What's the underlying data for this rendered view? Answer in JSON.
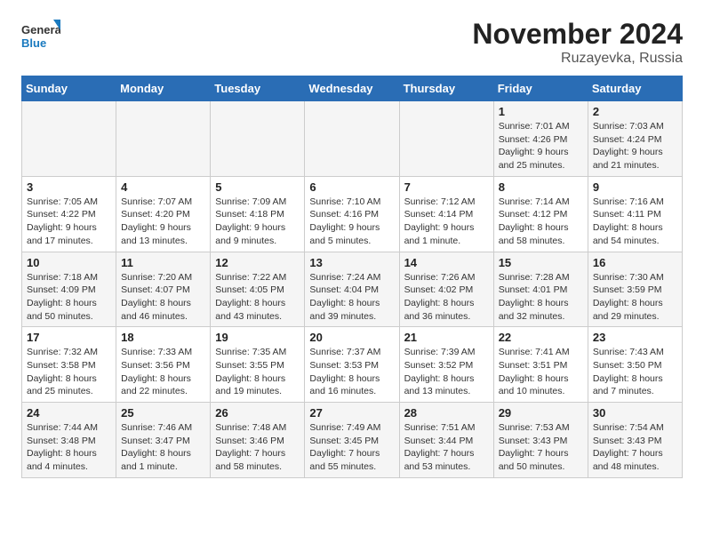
{
  "header": {
    "logo_general": "General",
    "logo_blue": "Blue",
    "month_year": "November 2024",
    "location": "Ruzayevka, Russia"
  },
  "weekdays": [
    "Sunday",
    "Monday",
    "Tuesday",
    "Wednesday",
    "Thursday",
    "Friday",
    "Saturday"
  ],
  "weeks": [
    [
      {
        "day": "",
        "info": ""
      },
      {
        "day": "",
        "info": ""
      },
      {
        "day": "",
        "info": ""
      },
      {
        "day": "",
        "info": ""
      },
      {
        "day": "",
        "info": ""
      },
      {
        "day": "1",
        "info": "Sunrise: 7:01 AM\nSunset: 4:26 PM\nDaylight: 9 hours\nand 25 minutes."
      },
      {
        "day": "2",
        "info": "Sunrise: 7:03 AM\nSunset: 4:24 PM\nDaylight: 9 hours\nand 21 minutes."
      }
    ],
    [
      {
        "day": "3",
        "info": "Sunrise: 7:05 AM\nSunset: 4:22 PM\nDaylight: 9 hours\nand 17 minutes."
      },
      {
        "day": "4",
        "info": "Sunrise: 7:07 AM\nSunset: 4:20 PM\nDaylight: 9 hours\nand 13 minutes."
      },
      {
        "day": "5",
        "info": "Sunrise: 7:09 AM\nSunset: 4:18 PM\nDaylight: 9 hours\nand 9 minutes."
      },
      {
        "day": "6",
        "info": "Sunrise: 7:10 AM\nSunset: 4:16 PM\nDaylight: 9 hours\nand 5 minutes."
      },
      {
        "day": "7",
        "info": "Sunrise: 7:12 AM\nSunset: 4:14 PM\nDaylight: 9 hours\nand 1 minute."
      },
      {
        "day": "8",
        "info": "Sunrise: 7:14 AM\nSunset: 4:12 PM\nDaylight: 8 hours\nand 58 minutes."
      },
      {
        "day": "9",
        "info": "Sunrise: 7:16 AM\nSunset: 4:11 PM\nDaylight: 8 hours\nand 54 minutes."
      }
    ],
    [
      {
        "day": "10",
        "info": "Sunrise: 7:18 AM\nSunset: 4:09 PM\nDaylight: 8 hours\nand 50 minutes."
      },
      {
        "day": "11",
        "info": "Sunrise: 7:20 AM\nSunset: 4:07 PM\nDaylight: 8 hours\nand 46 minutes."
      },
      {
        "day": "12",
        "info": "Sunrise: 7:22 AM\nSunset: 4:05 PM\nDaylight: 8 hours\nand 43 minutes."
      },
      {
        "day": "13",
        "info": "Sunrise: 7:24 AM\nSunset: 4:04 PM\nDaylight: 8 hours\nand 39 minutes."
      },
      {
        "day": "14",
        "info": "Sunrise: 7:26 AM\nSunset: 4:02 PM\nDaylight: 8 hours\nand 36 minutes."
      },
      {
        "day": "15",
        "info": "Sunrise: 7:28 AM\nSunset: 4:01 PM\nDaylight: 8 hours\nand 32 minutes."
      },
      {
        "day": "16",
        "info": "Sunrise: 7:30 AM\nSunset: 3:59 PM\nDaylight: 8 hours\nand 29 minutes."
      }
    ],
    [
      {
        "day": "17",
        "info": "Sunrise: 7:32 AM\nSunset: 3:58 PM\nDaylight: 8 hours\nand 25 minutes."
      },
      {
        "day": "18",
        "info": "Sunrise: 7:33 AM\nSunset: 3:56 PM\nDaylight: 8 hours\nand 22 minutes."
      },
      {
        "day": "19",
        "info": "Sunrise: 7:35 AM\nSunset: 3:55 PM\nDaylight: 8 hours\nand 19 minutes."
      },
      {
        "day": "20",
        "info": "Sunrise: 7:37 AM\nSunset: 3:53 PM\nDaylight: 8 hours\nand 16 minutes."
      },
      {
        "day": "21",
        "info": "Sunrise: 7:39 AM\nSunset: 3:52 PM\nDaylight: 8 hours\nand 13 minutes."
      },
      {
        "day": "22",
        "info": "Sunrise: 7:41 AM\nSunset: 3:51 PM\nDaylight: 8 hours\nand 10 minutes."
      },
      {
        "day": "23",
        "info": "Sunrise: 7:43 AM\nSunset: 3:50 PM\nDaylight: 8 hours\nand 7 minutes."
      }
    ],
    [
      {
        "day": "24",
        "info": "Sunrise: 7:44 AM\nSunset: 3:48 PM\nDaylight: 8 hours\nand 4 minutes."
      },
      {
        "day": "25",
        "info": "Sunrise: 7:46 AM\nSunset: 3:47 PM\nDaylight: 8 hours\nand 1 minute."
      },
      {
        "day": "26",
        "info": "Sunrise: 7:48 AM\nSunset: 3:46 PM\nDaylight: 7 hours\nand 58 minutes."
      },
      {
        "day": "27",
        "info": "Sunrise: 7:49 AM\nSunset: 3:45 PM\nDaylight: 7 hours\nand 55 minutes."
      },
      {
        "day": "28",
        "info": "Sunrise: 7:51 AM\nSunset: 3:44 PM\nDaylight: 7 hours\nand 53 minutes."
      },
      {
        "day": "29",
        "info": "Sunrise: 7:53 AM\nSunset: 3:43 PM\nDaylight: 7 hours\nand 50 minutes."
      },
      {
        "day": "30",
        "info": "Sunrise: 7:54 AM\nSunset: 3:43 PM\nDaylight: 7 hours\nand 48 minutes."
      }
    ]
  ]
}
